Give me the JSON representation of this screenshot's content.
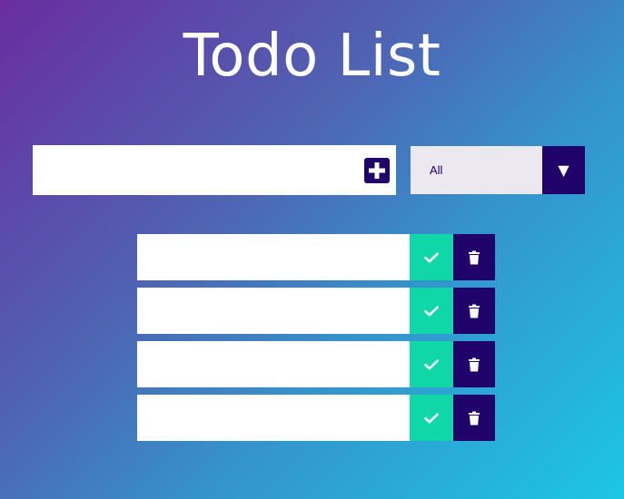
{
  "header": {
    "title": "Todo List"
  },
  "form": {
    "input_value": "",
    "input_placeholder": "",
    "add_icon": "plus-square-icon",
    "filter": {
      "selected": "All",
      "arrow_glyph": "▼"
    }
  },
  "todos": [
    {
      "text": ""
    },
    {
      "text": ""
    },
    {
      "text": ""
    },
    {
      "text": ""
    }
  ],
  "colors": {
    "gradient_start": "#6a2d9f",
    "gradient_end": "#1cc6e4",
    "primary_dark": "#20026b",
    "complete_green": "#0fd7a8",
    "filter_bg": "#ebe8ef"
  },
  "icons": {
    "complete": "check-icon",
    "delete": "trash-icon",
    "filter": "caret-down-icon"
  }
}
